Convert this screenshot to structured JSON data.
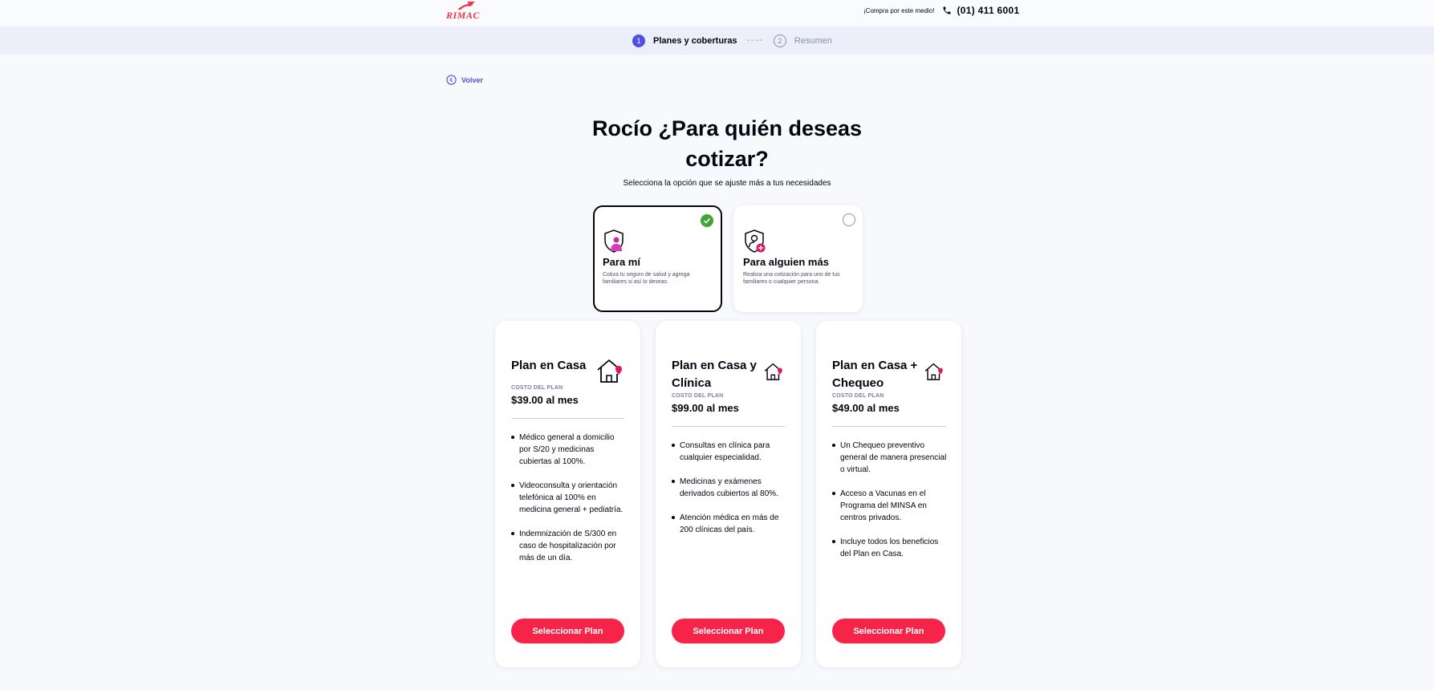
{
  "header": {
    "logo_text": "RIMAC",
    "buy_text": "¡Compra por este medio!",
    "phone": "(01) 411 6001"
  },
  "stepper": {
    "steps": [
      {
        "number": "1",
        "label": "Planes y coberturas",
        "active": true
      },
      {
        "number": "2",
        "label": "Resumen",
        "active": false
      }
    ],
    "separator": "----"
  },
  "back": {
    "label": "Volver"
  },
  "title": "Rocío ¿Para quién deseas cotizar?",
  "subtitle": "Selecciona la opción que se ajuste más a tus necesidades",
  "options": [
    {
      "title": "Para mí",
      "description": "Cotiza tu seguro de salud y agrega familiares si así lo deseas.",
      "selected": true
    },
    {
      "title": "Para alguien más",
      "description": "Realiza una cotización para uno de tus familiares o cualquier persona.",
      "selected": false
    }
  ],
  "plans": [
    {
      "name": "Plan en Casa",
      "cost_label": "COSTO DEL PLAN",
      "price": "$39.00 al mes",
      "features": [
        "Médico general a domicilio por S/20 y medicinas cubiertas al 100%.",
        "Videoconsulta y orientación telefónica al 100% en medicina general + pediatría.",
        "Indemnización de S/300 en caso de hospitalización por más de un día."
      ],
      "button": "Seleccionar Plan"
    },
    {
      "name": "Plan en Casa y Clínica",
      "cost_label": "COSTO DEL PLAN",
      "price": "$99.00 al mes",
      "features": [
        "Consultas en clínica para cualquier especialidad.",
        "Medicinas y exámenes derivados cubiertos al 80%.",
        "Atención médica en más de 200 clínicas del país."
      ],
      "button": "Seleccionar Plan"
    },
    {
      "name": "Plan en Casa + Chequeo",
      "cost_label": "COSTO DEL PLAN",
      "price": "$49.00 al mes",
      "features": [
        "Un Chequeo preventivo general de manera presencial o virtual.",
        "Acceso a Vacunas en el Programa del MINSA en centros privados.",
        "Incluye todos los beneficios del Plan en Casa."
      ],
      "button": "Seleccionar Plan"
    }
  ],
  "colors": {
    "brand_red": "#ef3340",
    "button_red": "#f7244a",
    "accent_blue": "#4f4fe0",
    "check_green": "#3fa535",
    "stepper_bg": "#eceffa"
  }
}
